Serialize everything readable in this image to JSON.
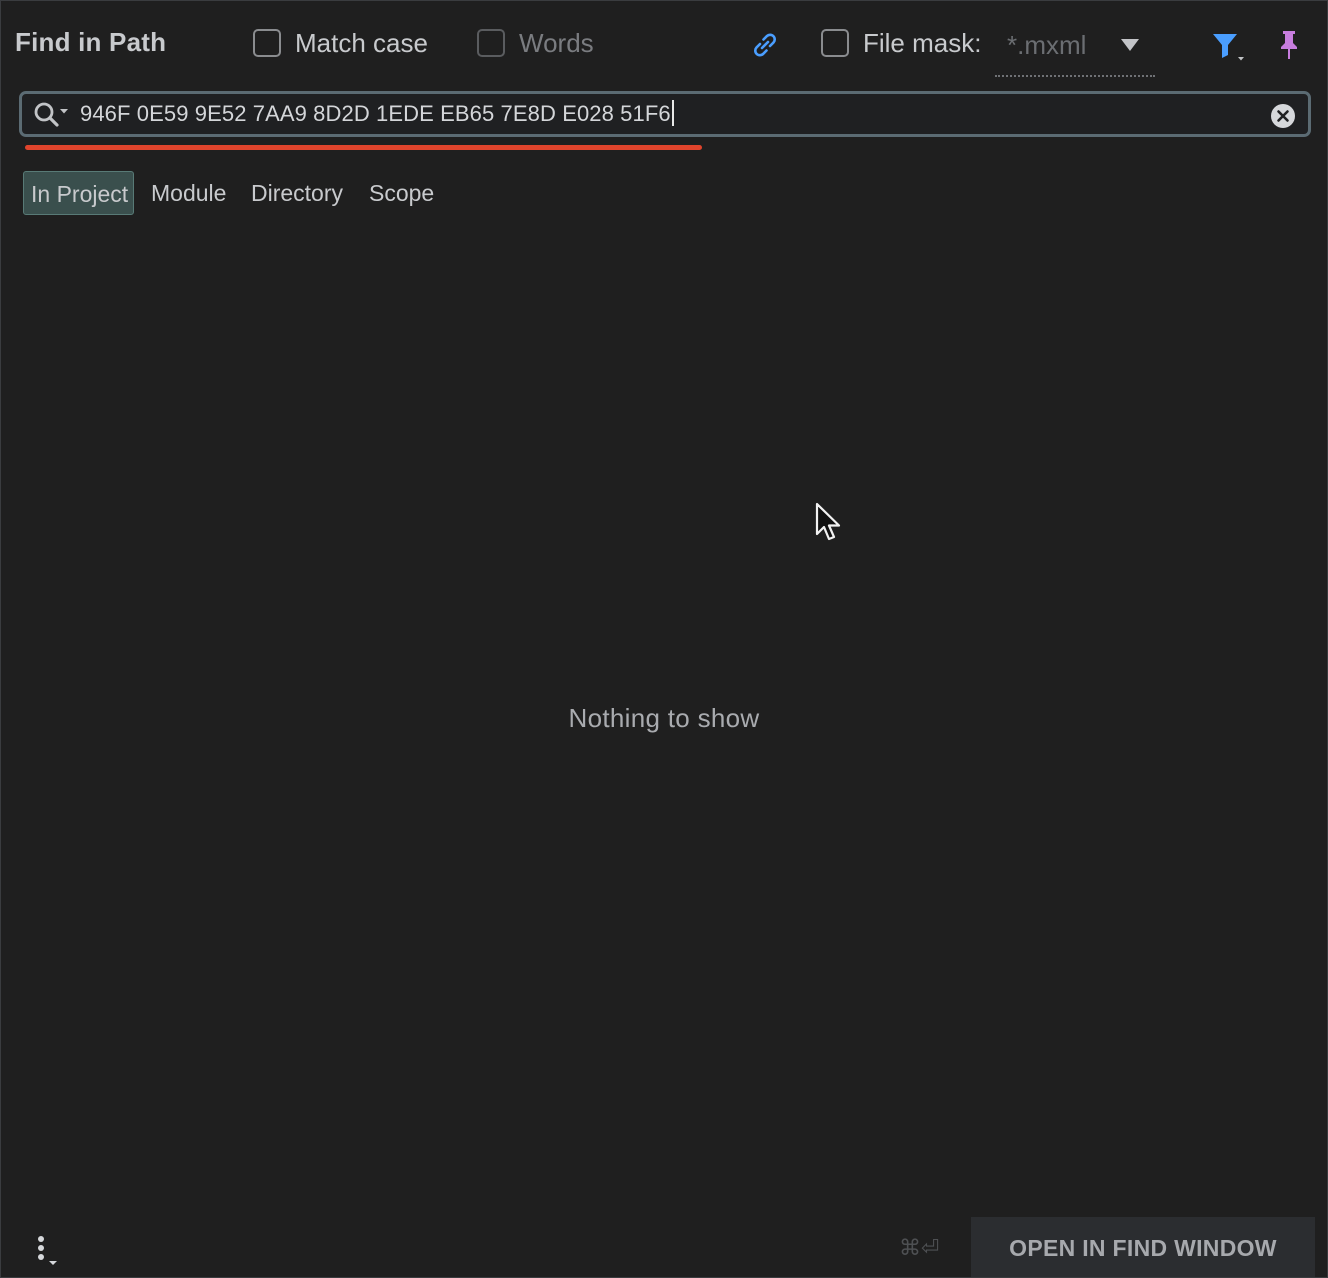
{
  "header": {
    "title": "Find in Path",
    "match_case_label": "Match case",
    "words_label": "Words",
    "file_mask_label": "File mask:",
    "file_mask_value": "*.mxml"
  },
  "search": {
    "query": "946F 0E59 9E52 7AA9 8D2D 1EDE EB65 7E8D E028 51F6"
  },
  "scope_tabs": [
    {
      "label": "In Project",
      "active": true
    },
    {
      "label": "Module",
      "active": false
    },
    {
      "label": "Directory",
      "active": false
    },
    {
      "label": "Scope",
      "active": false
    }
  ],
  "results": {
    "empty_message": "Nothing to show"
  },
  "footer": {
    "shortcut_hint": "⌘⏎",
    "open_button_label": "OPEN IN FIND WINDOW"
  },
  "colors": {
    "accent_blue": "#4a9eff",
    "pin_purple": "#c77dde",
    "error_red": "#e0442c",
    "active_tab_bg": "#3a4f4d"
  },
  "icons": {
    "link": "link-icon",
    "filter": "filter-icon",
    "pin": "pin-icon",
    "search": "search-icon",
    "clear": "clear-icon",
    "more": "more-vertical-icon"
  }
}
